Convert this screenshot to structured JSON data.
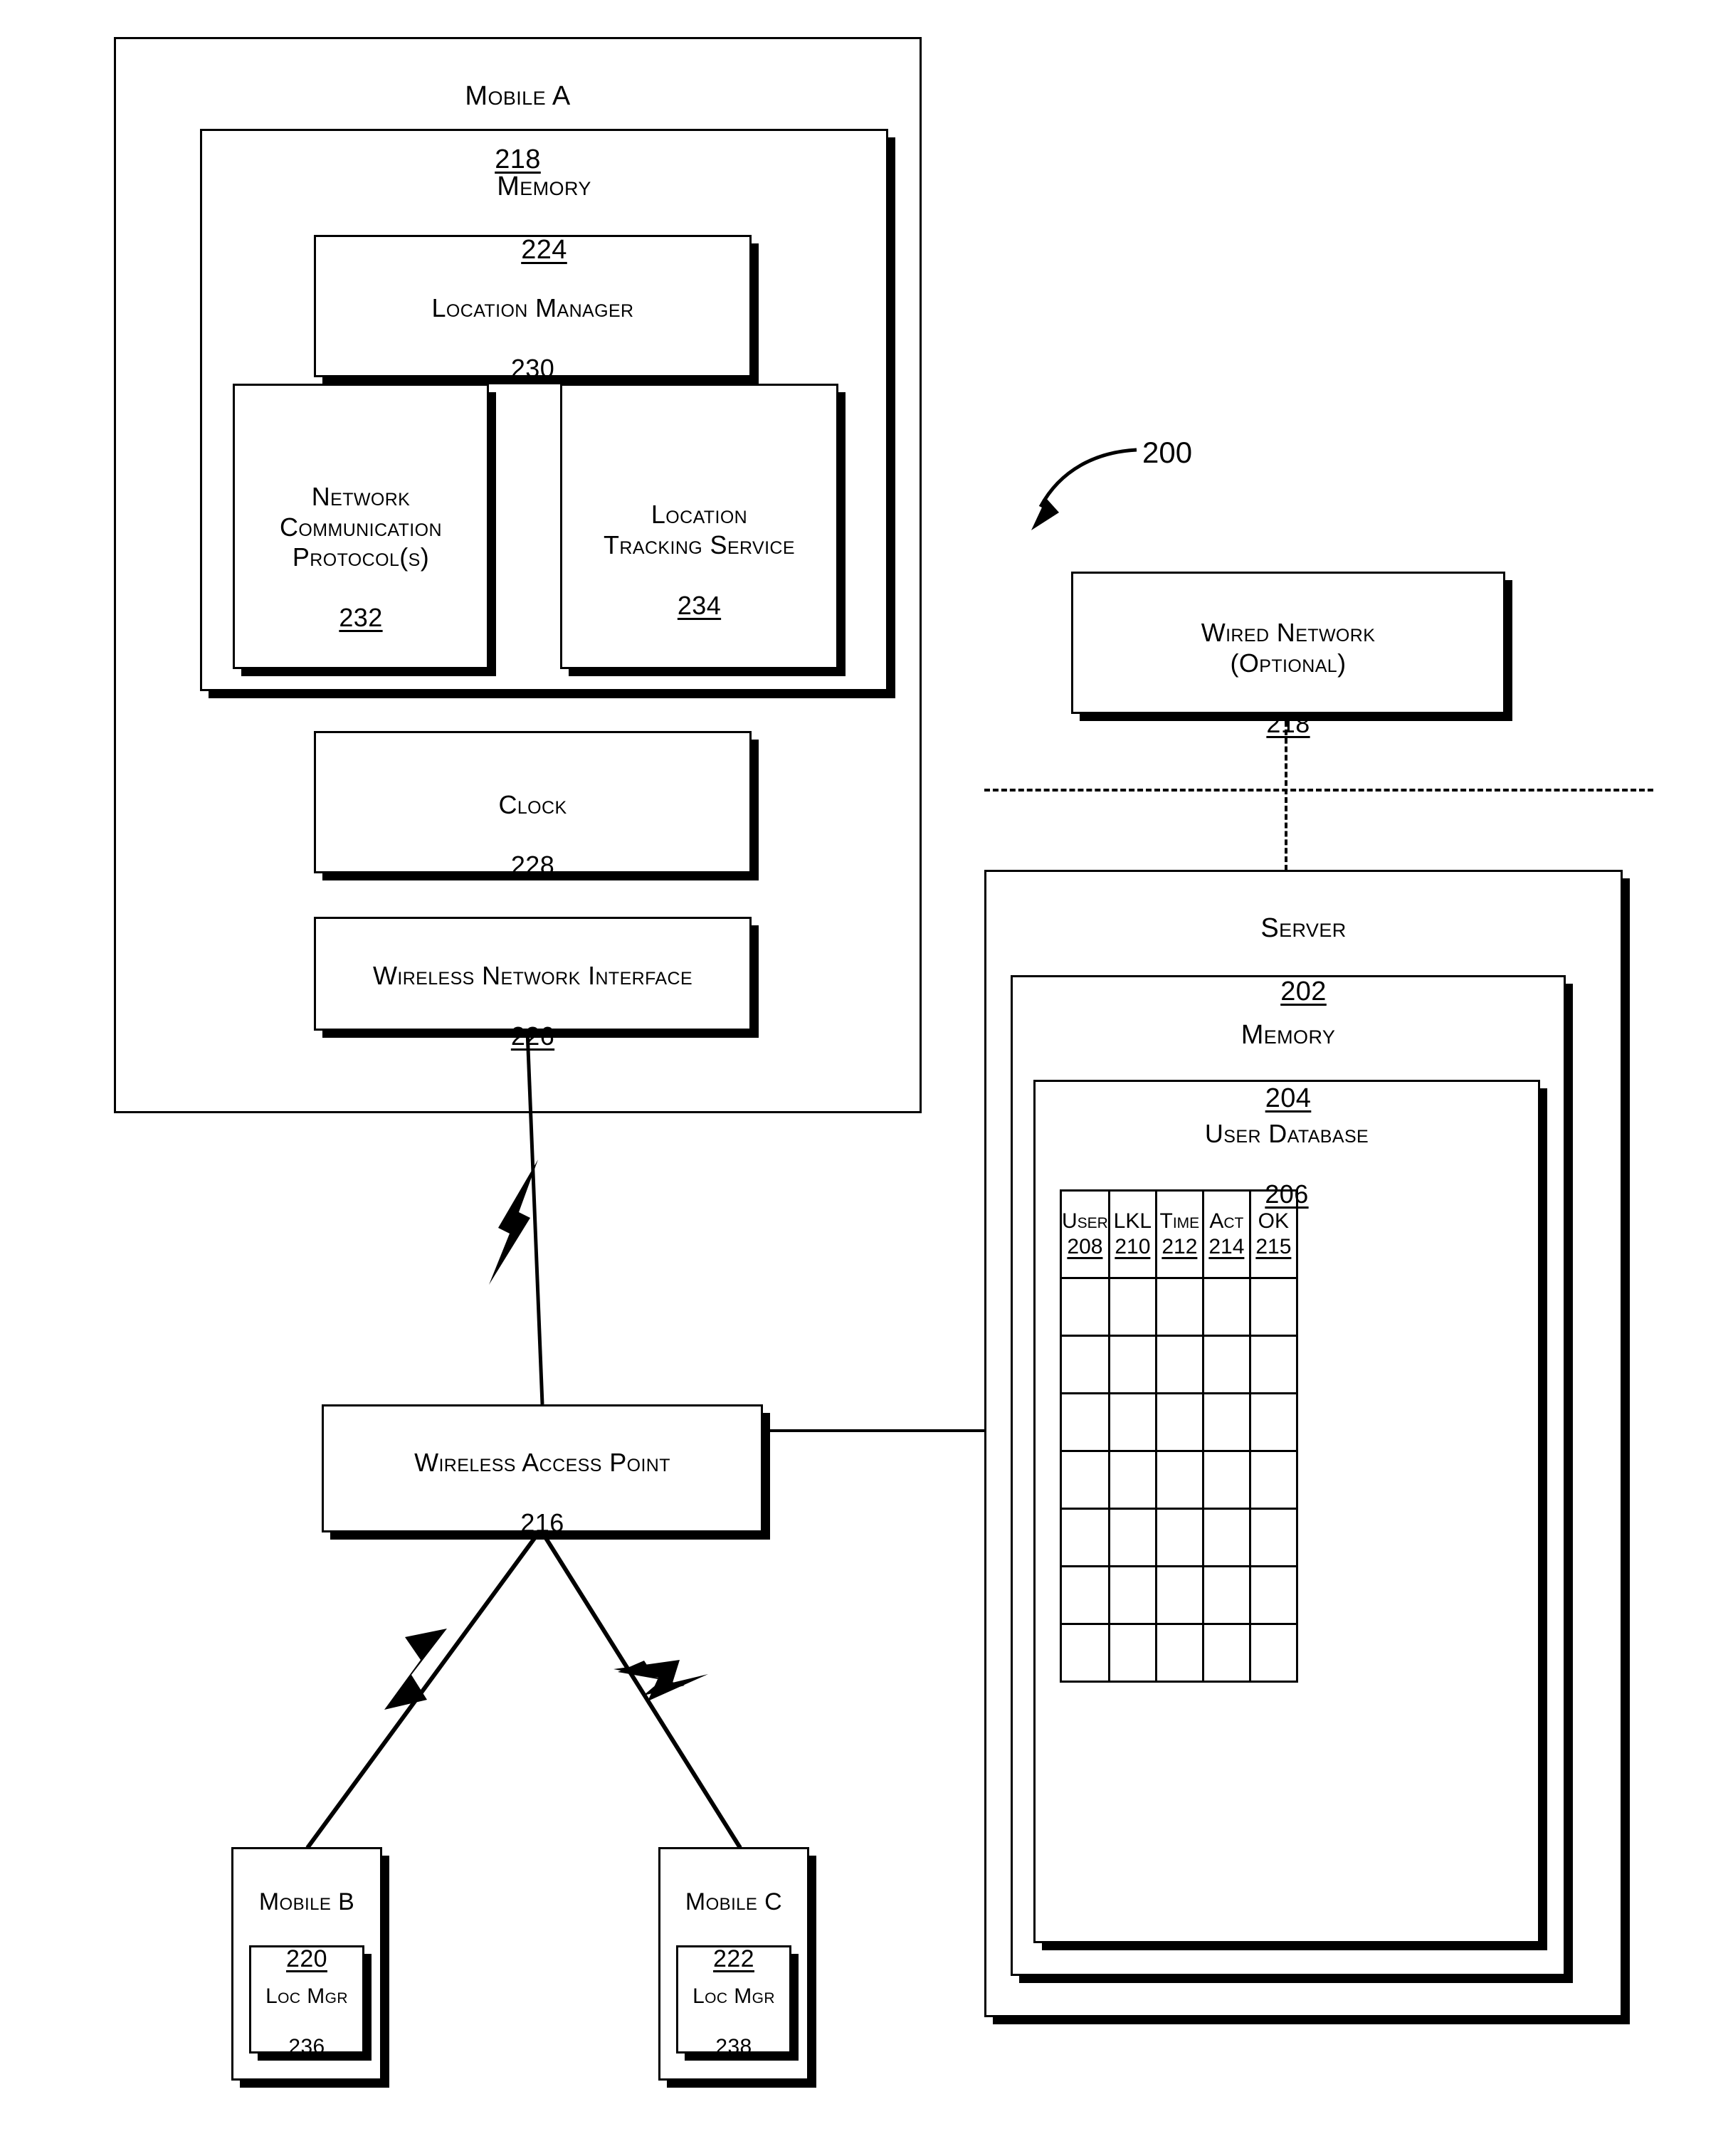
{
  "figure": {
    "reference_numeral": "200"
  },
  "mobile_a": {
    "title": "Mobile A",
    "num": "218",
    "memory": {
      "title": "Memory",
      "num": "224",
      "location_manager": {
        "title": "Location Manager",
        "num": "230"
      },
      "network_protocols": {
        "title": "Network\nCommunication\nProtocol(s)",
        "num": "232"
      },
      "location_tracking": {
        "title": "Location\nTracking Service",
        "num": "234"
      }
    },
    "clock": {
      "title": "Clock",
      "num": "228"
    },
    "wireless_interface": {
      "title": "Wireless Network Interface",
      "num": "226"
    }
  },
  "wired_network": {
    "title": "Wired Network\n(Optional)",
    "num": "218"
  },
  "server": {
    "title": "Server",
    "num": "202",
    "memory": {
      "title": "Memory",
      "num": "204"
    },
    "user_database": {
      "title": "User Database",
      "num": "206",
      "columns": [
        {
          "label": "User",
          "num": "208"
        },
        {
          "label": "LKL",
          "num": "210"
        },
        {
          "label": "Time",
          "num": "212"
        },
        {
          "label": "Act",
          "num": "214"
        },
        {
          "label": "OK",
          "num": "215"
        }
      ],
      "empty_row_count": 7
    }
  },
  "wireless_access_point": {
    "title": "Wireless Access Point",
    "num": "216"
  },
  "mobile_b": {
    "title": "Mobile B",
    "num": "220",
    "loc_mgr": {
      "title": "Loc Mgr",
      "num": "236"
    }
  },
  "mobile_c": {
    "title": "Mobile C",
    "num": "222",
    "loc_mgr": {
      "title": "Loc Mgr",
      "num": "238"
    }
  },
  "colors": {
    "ink": "#000000",
    "paper": "#ffffff"
  }
}
